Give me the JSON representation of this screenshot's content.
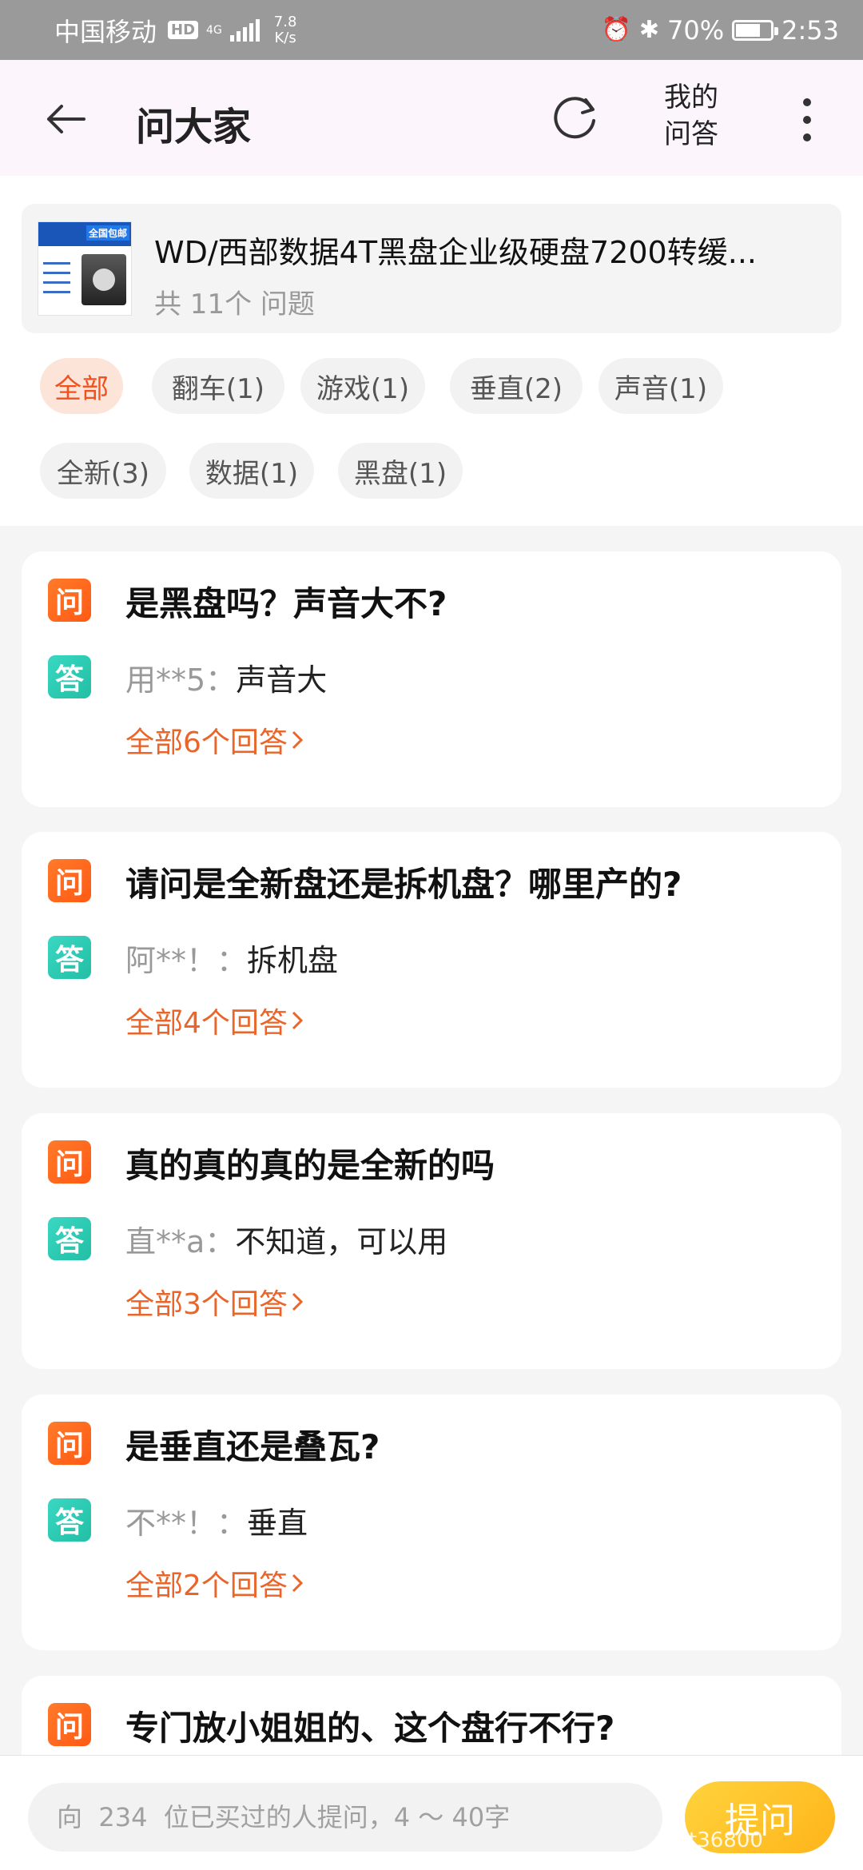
{
  "status_bar": {
    "carrier": "中国移动",
    "hd": "HD",
    "network": "4G",
    "speed_value": "7.8",
    "speed_unit": "K/s",
    "battery": "70%",
    "time": "2:53"
  },
  "header": {
    "title": "问大家",
    "my_qa_line1": "我的",
    "my_qa_line2": "问答"
  },
  "product": {
    "title": "WD/西部数据4T黑盘企业级硬盘7200转缓...",
    "question_count": "共 11个 问题",
    "thumb_tag": "全国包邮"
  },
  "tags": [
    {
      "label": "全部"
    },
    {
      "label": "翻车(1)"
    },
    {
      "label": "游戏(1)"
    },
    {
      "label": "垂直(2)"
    },
    {
      "label": "声音(1)"
    },
    {
      "label": "全新(3)"
    },
    {
      "label": "数据(1)"
    },
    {
      "label": "黑盘(1)"
    }
  ],
  "badges": {
    "question": "问",
    "answer": "答"
  },
  "questions": [
    {
      "question": "是黑盘吗？声音大不?",
      "answer_user": "用**5：",
      "answer": "声音大",
      "all_answers": "全部6个回答"
    },
    {
      "question": "请问是全新盘还是拆机盘？哪里产的?",
      "answer_user": "阿**！：",
      "answer": "拆机盘",
      "all_answers": "全部4个回答"
    },
    {
      "question": "真的真的真的是全新的吗",
      "answer_user": "直**a：",
      "answer": "不知道，可以用",
      "all_answers": "全部3个回答"
    },
    {
      "question": "是垂直还是叠瓦?",
      "answer_user": "不**！：",
      "answer": "垂直",
      "all_answers": "全部2个回答"
    },
    {
      "question": "专门放小姐姐的、这个盘行不行?"
    }
  ],
  "bottom": {
    "placeholder": "向  234  位已买过的人提问，4 ～ 40字",
    "ask_label": "提问",
    "watermark": "@et36800"
  }
}
